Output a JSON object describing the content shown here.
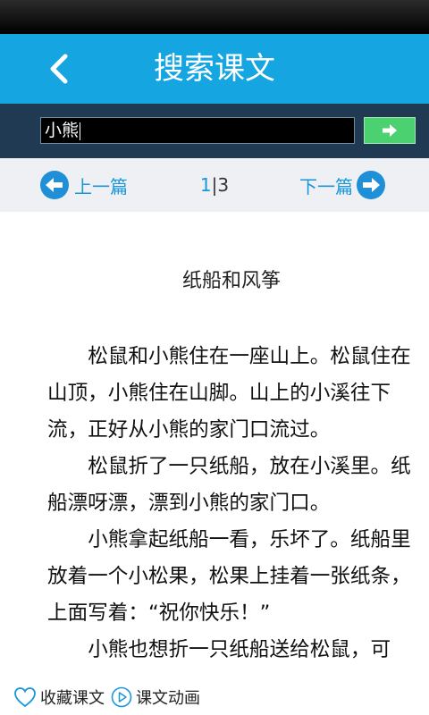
{
  "header": {
    "title": "搜索课文"
  },
  "search": {
    "value": "小熊"
  },
  "pager": {
    "prev_label": "上一篇",
    "next_label": "下一篇",
    "current": "1",
    "separator": "|",
    "total": "3"
  },
  "article": {
    "title": "纸船和风筝",
    "paragraphs": [
      "松鼠和小熊住在一座山上。松鼠住在山顶，小熊住在山脚。山上的小溪往下流，正好从小熊的家门口流过。",
      "松鼠折了一只纸船，放在小溪里。纸船漂呀漂，漂到小熊的家门口。",
      "小熊拿起纸船一看，乐坏了。纸船里放着一个小松果，松果上挂着一张纸条，上面写着：“祝你快乐！”",
      "小熊也想折一只纸船送给松鼠，可"
    ]
  },
  "footer": {
    "favorite_label": "收藏课文",
    "animation_label": "课文动画"
  },
  "colors": {
    "accent": "#15a5e1",
    "search_bar": "#1f3a52",
    "search_button": "#4cd170",
    "link": "#1996dc"
  }
}
